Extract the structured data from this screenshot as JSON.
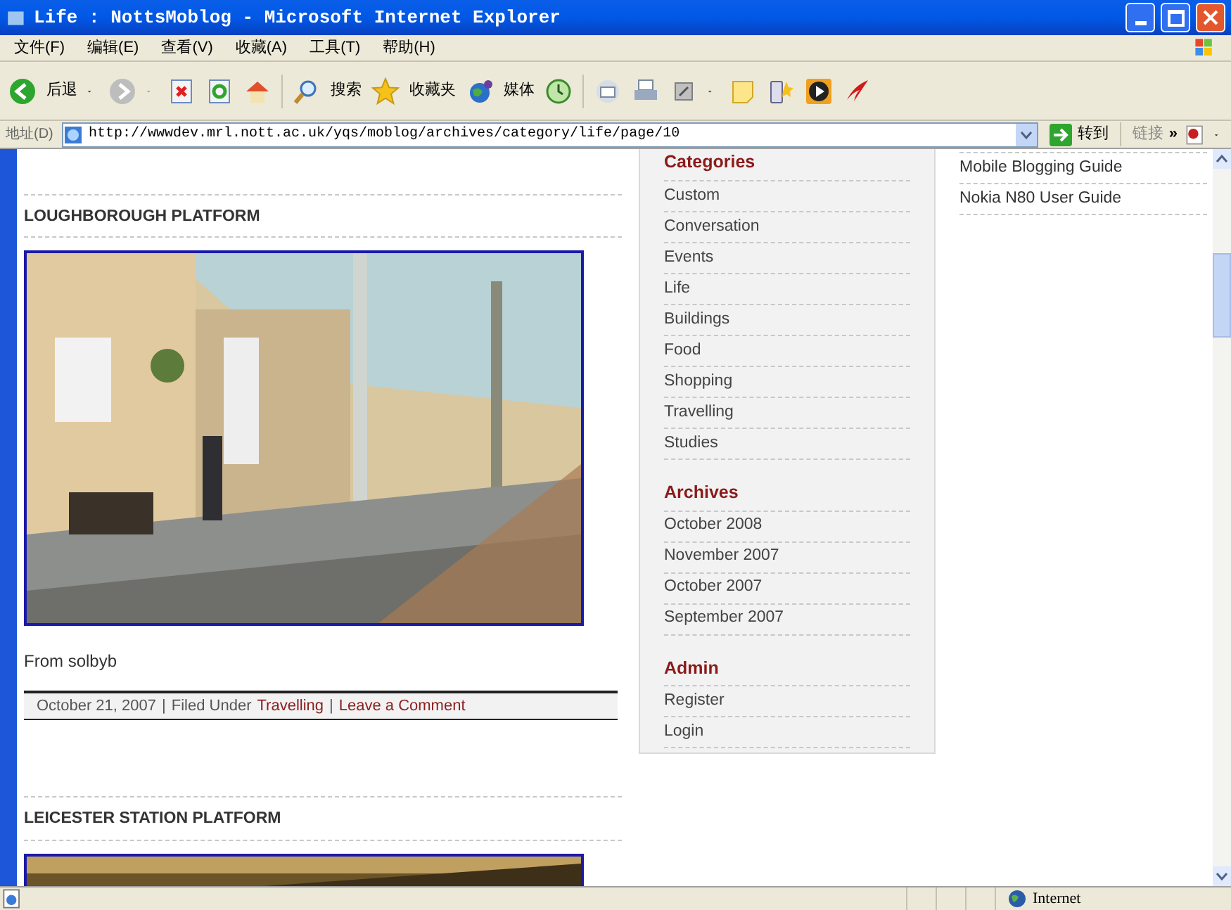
{
  "window": {
    "title": "Life : NottsMoblog - Microsoft Internet Explorer"
  },
  "menu": [
    "文件(F)",
    "编辑(E)",
    "查看(V)",
    "收藏(A)",
    "工具(T)",
    "帮助(H)"
  ],
  "toolbar": {
    "back": "后退",
    "search": "搜索",
    "favorites": "收藏夹",
    "media": "媒体"
  },
  "address_bar": {
    "label": "地址(D)",
    "url": "http://wwwdev.mrl.nott.ac.uk/yqs/moblog/archives/category/life/page/10",
    "go": "转到",
    "links": "链接",
    "more": "»"
  },
  "posts": [
    {
      "title": "LOUGHBOROUGH PLATFORM",
      "caption": "From solbyb",
      "meta": {
        "date": "October 21, 2007",
        "filed": "Filed Under",
        "category": "Travelling",
        "comment": "Leave a Comment",
        "sep": "|"
      }
    },
    {
      "title": "LEICESTER STATION PLATFORM"
    }
  ],
  "sidebar": [
    {
      "heading": "Categories",
      "items": [
        "Custom",
        "Conversation",
        "Events",
        "Life",
        "Buildings",
        "Food",
        "Shopping",
        "Travelling",
        "Studies"
      ]
    },
    {
      "heading": "Archives",
      "items": [
        "October 2008",
        "November 2007",
        "October 2007",
        "September 2007"
      ]
    },
    {
      "heading": "Admin",
      "items": [
        "Register",
        "Login"
      ]
    }
  ],
  "links": [
    "Mobile Blogging Guide",
    "Nokia N80 User Guide"
  ],
  "status_bar": {
    "zone": "Internet"
  }
}
